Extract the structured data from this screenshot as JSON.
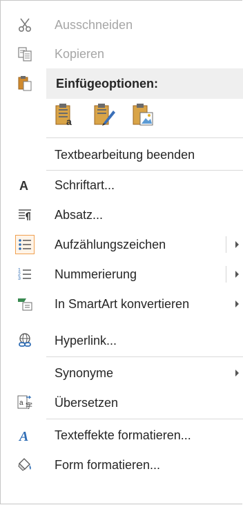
{
  "menu": {
    "cut": {
      "label": "Ausschneiden",
      "icon": "scissors-icon"
    },
    "copy": {
      "label": "Kopieren",
      "icon": "copy-icon"
    },
    "paste_options": {
      "label": "Einfügeoptionen:",
      "icon": "clipboard-icon"
    },
    "paste_buttons": [
      {
        "name": "paste-keep-text-only-button",
        "icon": "paste-text-icon"
      },
      {
        "name": "paste-keep-formatting-button",
        "icon": "paste-formatting-icon"
      },
      {
        "name": "paste-picture-button",
        "icon": "paste-picture-icon"
      }
    ],
    "end_text_edit": {
      "label": "Textbearbeitung beenden"
    },
    "font": {
      "label": "Schriftart...",
      "icon": "font-icon"
    },
    "paragraph": {
      "label": "Absatz...",
      "icon": "paragraph-icon"
    },
    "bullets": {
      "label": "Aufzählungszeichen",
      "icon": "bullets-icon"
    },
    "numbering": {
      "label": "Nummerierung",
      "icon": "numbering-icon"
    },
    "smartart": {
      "label": "In SmartArt konvertieren",
      "icon": "smartart-icon"
    },
    "hyperlink": {
      "label": "Hyperlink...",
      "icon": "hyperlink-icon"
    },
    "synonyms": {
      "label": "Synonyme"
    },
    "translate": {
      "label": "Übersetzen",
      "icon": "translate-icon"
    },
    "text_effects": {
      "label": "Texteffekte formatieren...",
      "icon": "text-effects-icon"
    },
    "shape_format": {
      "label": "Form formatieren...",
      "icon": "format-shape-icon"
    }
  },
  "colors": {
    "accent": "#f0a050",
    "text": "#262626",
    "disabled": "#a6a6a6",
    "blue": "#2f6db5",
    "green": "#3a8a52"
  }
}
